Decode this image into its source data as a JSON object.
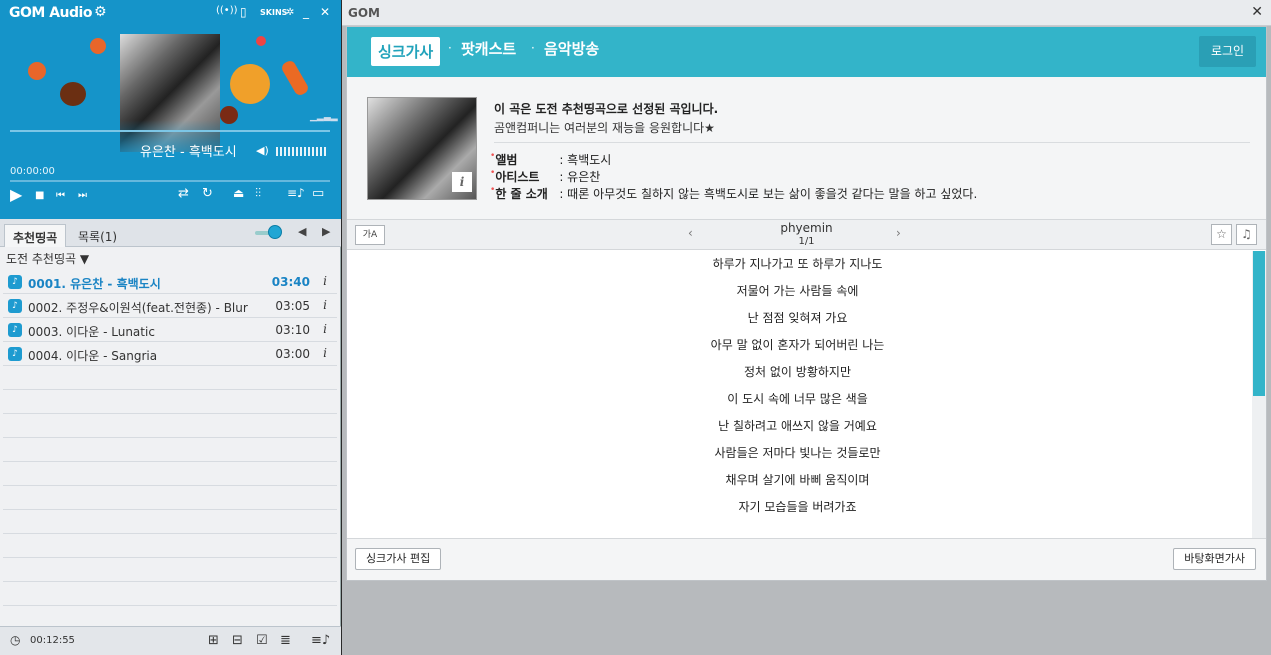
{
  "player": {
    "app_title": "GOM Audio",
    "skins_label": "SKINS",
    "now_playing": "유은찬 - 흑백도시",
    "current_time": "00:00:00",
    "volume_level": 0.8
  },
  "playlist": {
    "tabs": [
      {
        "label": "추천띵곡"
      },
      {
        "label": "목록(1)"
      }
    ],
    "list_name": "도전 추천띵곡 ▼",
    "items": [
      {
        "title": "0001. 유은찬 - 흑백도시",
        "duration": "03:40"
      },
      {
        "title": "0002. 주정우&이원석(feat.전현종) - Blur",
        "duration": "03:05"
      },
      {
        "title": "0003. 이다운 - Lunatic",
        "duration": "03:10"
      },
      {
        "title": "0004. 이다운 - Sangria",
        "duration": "03:00"
      }
    ],
    "total_time": "00:12:55"
  },
  "panel": {
    "window_title": "GOM",
    "tabs": [
      {
        "label": "싱크가사"
      },
      {
        "label": "팟캐스트"
      },
      {
        "label": "음악방송"
      }
    ],
    "login_label": "로그인",
    "notice_title": "이 곡은 도전 추천띵곡으로 선정된 곡입니다.",
    "notice_sub": "곰앤컴퍼니는 여러분의 재능을 응원합니다★",
    "meta": {
      "album_key": "앨범",
      "album_value": ": 흑백도시",
      "artist_key": "아티스트",
      "artist_value": ": 유은찬",
      "intro_key": "한 줄 소개",
      "intro_value": ": 때론 아무것도 칠하지 않는 흑백도시로 보는 삶이 좋을것 같다는 말을 하고 싶었다."
    },
    "lyric_author": "phyemin",
    "lyric_page": "1/1",
    "ka_label": "가A",
    "lyrics": [
      "하루가 지나가고 또 하루가 지나도",
      "저물어 가는 사람들 속에",
      "난 점점 잊혀져 가요",
      "아무 말 없이 혼자가 되어버린 나는",
      "정처 없이 방황하지만",
      "이 도시 속에 너무 많은 색을",
      "난 칠하려고 애쓰지 않을 거예요",
      "사람들은 저마다 빛나는 것들로만",
      "채우며 살기에 바삐 움직이며",
      "자기 모습들을 버려가죠"
    ],
    "edit_label": "싱크가사 편집",
    "desktop_label": "바탕화면가사",
    "accent": "#33b4c9"
  }
}
